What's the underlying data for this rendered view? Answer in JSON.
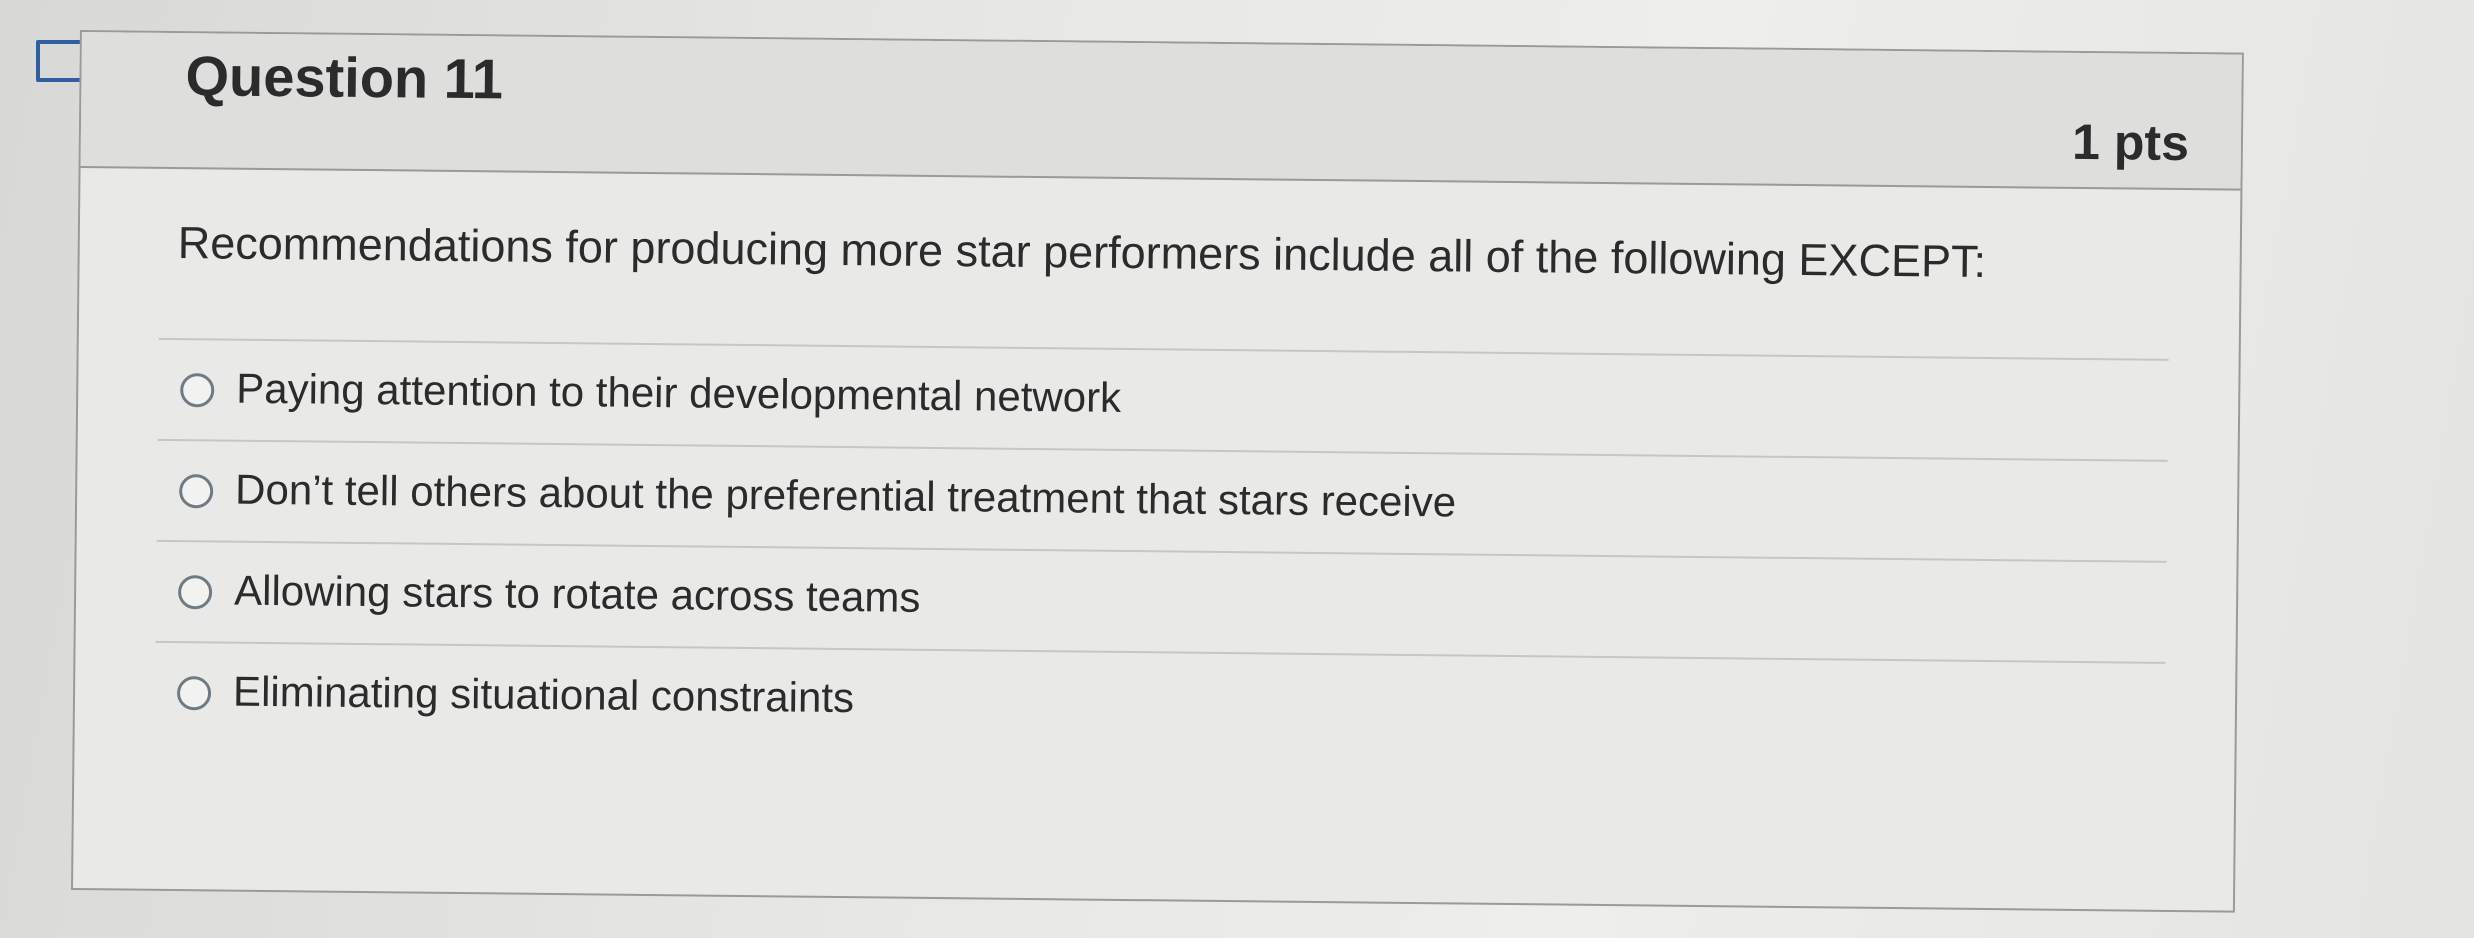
{
  "icons": {
    "flag": "flag-outline-icon",
    "radio": "radio-empty-icon"
  },
  "colors": {
    "text": "#2b2b2b",
    "card_border": "#9a9a98",
    "header_bg": "#dededc"
  },
  "question": {
    "title": "Question 11",
    "points": "1 pts",
    "text": "Recommendations for producing more star performers include all of the following EXCEPT:",
    "answers": [
      {
        "label": "Paying attention to their developmental network"
      },
      {
        "label": "Don’t tell others about the preferential treatment that stars receive"
      },
      {
        "label": "Allowing stars to rotate across teams"
      },
      {
        "label": "Eliminating situational constraints"
      }
    ]
  }
}
